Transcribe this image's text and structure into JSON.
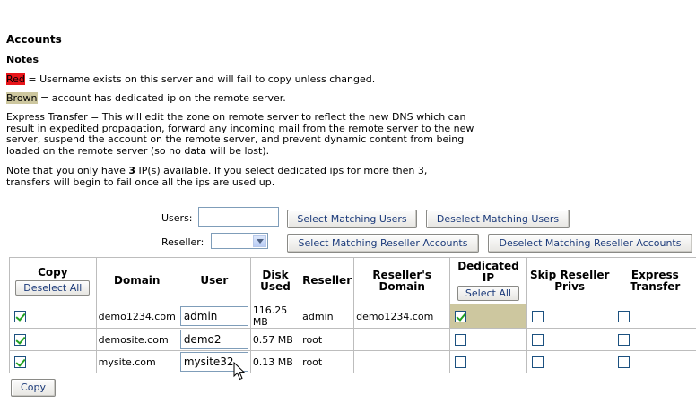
{
  "page": {
    "title": "Accounts",
    "notes_heading": "Notes",
    "note_red_swatch": "Red",
    "note_red_text": " = Username exists on this server and will fail to copy unless changed.",
    "note_brown_swatch": "Brown",
    "note_brown_text": " = account has dedicated ip on the remote server.",
    "express_note": "Express Transfer = This will edit the zone on remote server to reflect the new DNS which can result in expedited propagation, forward any incoming mail from the remote server to the new server, suspend the account on the remote server, and prevent dynamic content from being loaded on the remote server (so no data will be lost).",
    "ip_note_prefix": "Note that you only have ",
    "ip_count": "3",
    "ip_note_suffix": " IP(s) available. If you select dedicated ips for more then 3, transfers will begin to fail once all the ips are used up."
  },
  "filters": {
    "users_label": "Users:",
    "users_value": "",
    "reseller_label": "Reseller:",
    "reseller_value": "",
    "select_matching_users": "Select Matching Users",
    "deselect_matching_users": "Deselect Matching Users",
    "select_matching_resellers": "Select Matching Reseller Accounts",
    "deselect_matching_resellers": "Deselect Matching Reseller Accounts"
  },
  "table": {
    "headers": {
      "copy": "Copy",
      "deselect_all": "Deselect All",
      "domain": "Domain",
      "user": "User",
      "disk_used": "Disk Used",
      "reseller": "Reseller",
      "resellers_domain": "Reseller's Domain",
      "dedicated_ip": "Dedicated IP",
      "select_all": "Select All",
      "skip_reseller_privs": "Skip Reseller Privs",
      "express_transfer": "Express Transfer"
    },
    "rows": [
      {
        "copy": true,
        "domain": "demo1234.com",
        "user": "admin",
        "disk_used": "116.25 MB",
        "reseller": "admin",
        "resellers_domain": "demo1234.com",
        "dedicated_ip": true,
        "skip_reseller_privs": false,
        "express_transfer": false
      },
      {
        "copy": true,
        "domain": "demosite.com",
        "user": "demo2",
        "disk_used": "0.57 MB",
        "reseller": "root",
        "resellers_domain": "",
        "dedicated_ip": false,
        "skip_reseller_privs": false,
        "express_transfer": false
      },
      {
        "copy": true,
        "domain": "mysite.com",
        "user": "mysite32",
        "disk_used": "0.13 MB",
        "reseller": "root",
        "resellers_domain": "",
        "dedicated_ip": false,
        "skip_reseller_privs": false,
        "express_transfer": false
      }
    ]
  },
  "actions": {
    "copy_button": "Copy"
  },
  "colors": {
    "red_note": "#e8151a",
    "brown_note": "#cdc79f",
    "button_text": "#1b3a7a"
  }
}
